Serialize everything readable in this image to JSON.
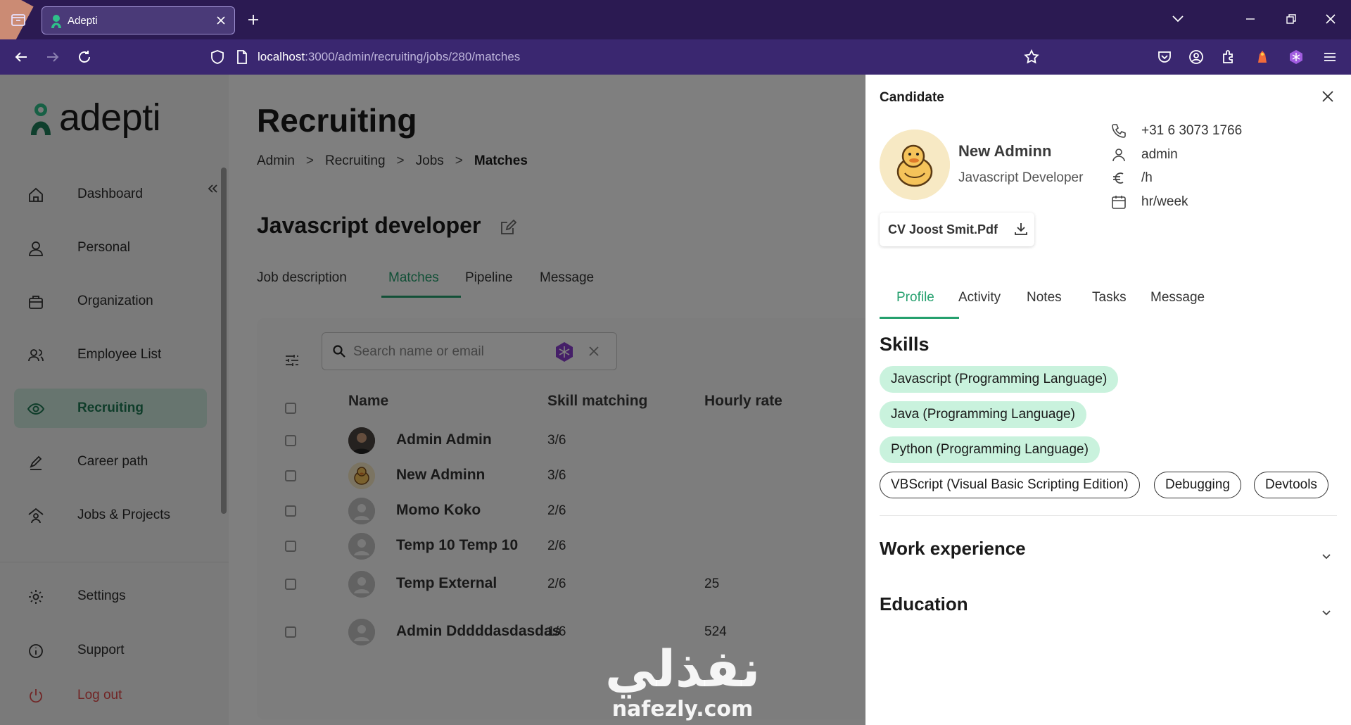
{
  "browser": {
    "tab_title": "Adepti",
    "url_host": "localhost",
    "url_path": ":3000/admin/recruiting/jobs/280/matches"
  },
  "sidebar": {
    "logo_text": "adepti",
    "items": [
      {
        "label": "Dashboard",
        "icon": "home-icon"
      },
      {
        "label": "Personal",
        "icon": "person-icon"
      },
      {
        "label": "Organization",
        "icon": "briefcase-icon"
      },
      {
        "label": "Employee List",
        "icon": "people-icon"
      },
      {
        "label": "Recruiting",
        "icon": "eye-icon",
        "active": true
      },
      {
        "label": "Career path",
        "icon": "pencil-icon"
      },
      {
        "label": "Jobs & Projects",
        "icon": "house-person-icon"
      }
    ],
    "bottom": [
      {
        "label": "Settings",
        "icon": "gear-icon"
      },
      {
        "label": "Support",
        "icon": "info-icon"
      },
      {
        "label": "Log out",
        "icon": "power-icon"
      }
    ]
  },
  "page": {
    "title": "Recruiting",
    "breadcrumb": [
      "Admin",
      "Recruiting",
      "Jobs",
      "Matches"
    ],
    "job_title": "Javascript developer",
    "tabs": [
      "Job description",
      "Matches",
      "Pipeline",
      "Message"
    ],
    "active_tab": "Matches"
  },
  "matches": {
    "search_placeholder": "Search name or email",
    "columns": {
      "name": "Name",
      "skill": "Skill matching",
      "rate": "Hourly rate"
    },
    "rows": [
      {
        "name": "Admin Admin",
        "skill": "3/6",
        "rate": "",
        "avatar": "photo"
      },
      {
        "name": "New Adminn",
        "skill": "3/6",
        "rate": "",
        "avatar": "duck"
      },
      {
        "name": "Momo Koko",
        "skill": "2/6",
        "rate": "",
        "avatar": "default"
      },
      {
        "name": "Temp 10 Temp 10",
        "skill": "2/6",
        "rate": "",
        "avatar": "default"
      },
      {
        "name": "Temp External",
        "skill": "2/6",
        "rate": "25",
        "avatar": "default"
      },
      {
        "name": "Admin Dddddasdasdas",
        "skill": "1/6",
        "rate": "524",
        "avatar": "default"
      }
    ]
  },
  "candidate": {
    "panel_title": "Candidate",
    "name": "New Adminn",
    "role": "Javascript Developer",
    "cv_file": "CV Joost Smit.Pdf",
    "phone": "+31 6 3073 1766",
    "username": "admin",
    "rate": "/h",
    "hours": "hr/week",
    "tabs": [
      "Profile",
      "Activity",
      "Notes",
      "Tasks",
      "Message"
    ],
    "active_tab": "Profile",
    "skills_heading": "Skills",
    "skills": [
      {
        "label": "Javascript (Programming Language)",
        "matched": true
      },
      {
        "label": "Java (Programming Language)",
        "matched": true
      },
      {
        "label": "Python (Programming Language)",
        "matched": true
      },
      {
        "label": "VBScript (Visual Basic Scripting Edition)",
        "matched": false
      },
      {
        "label": "Debugging",
        "matched": false
      },
      {
        "label": "Devtools",
        "matched": false
      }
    ],
    "work_heading": "Work experience",
    "education_heading": "Education"
  },
  "watermark": {
    "arabic": "نفذلي",
    "latin": "nafezly.com"
  },
  "colors": {
    "accent": "#25a06e",
    "chip_fill": "#c9f2dd",
    "browser_bg": "#2b1a52",
    "logout": "#e24b4b"
  }
}
